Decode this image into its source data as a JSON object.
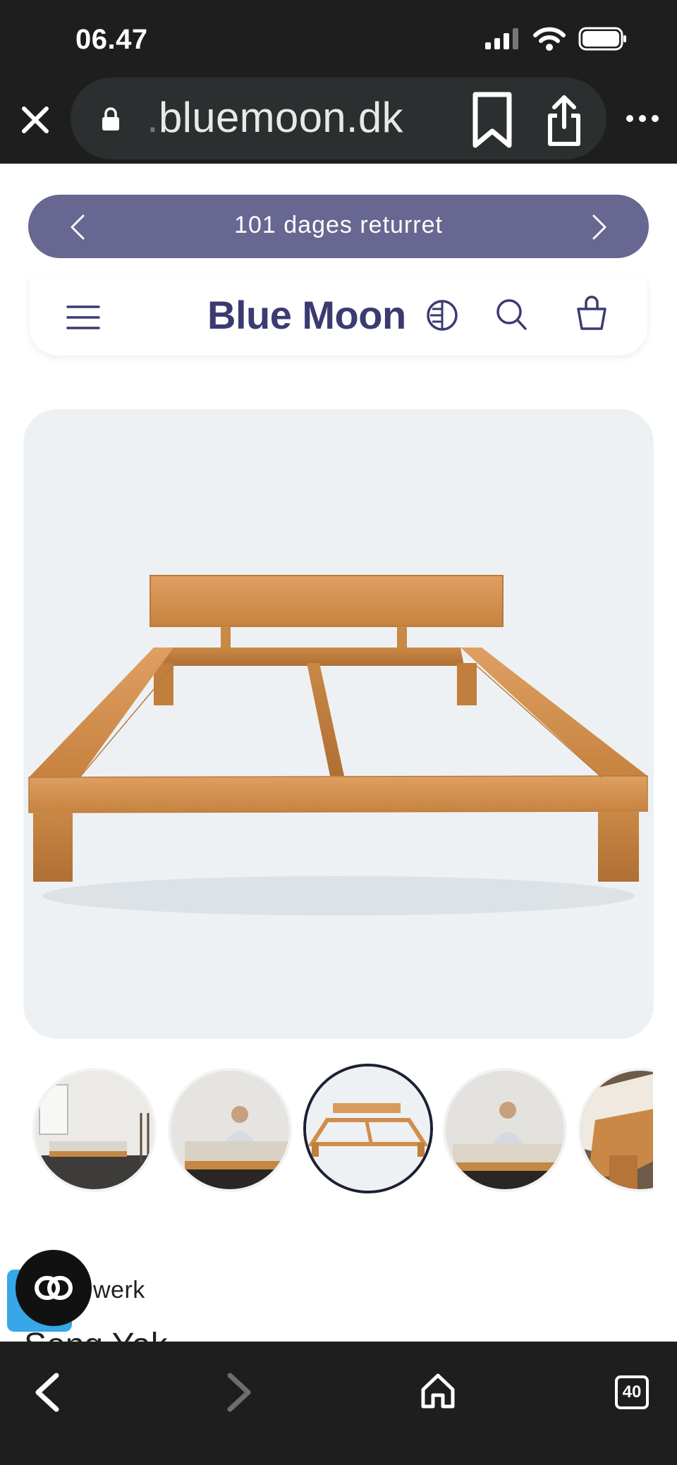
{
  "status_bar": {
    "time": "06.47"
  },
  "browser": {
    "url_prefix": ".",
    "url_domain": "bluemoon.dk",
    "tab_count": "40"
  },
  "promo": {
    "text": "101 dages returret"
  },
  "header": {
    "brand": "Blue Moon"
  },
  "product": {
    "category_partial": "werk",
    "title_partial": "Seng Yak"
  },
  "gallery": {
    "thumbnail_count": 5,
    "active_index": 2
  },
  "colors": {
    "promo_bg": "#676791",
    "brand": "#3b3b72",
    "chrome_bg": "#1e1e1e",
    "hero_bg": "#eef1f3"
  }
}
